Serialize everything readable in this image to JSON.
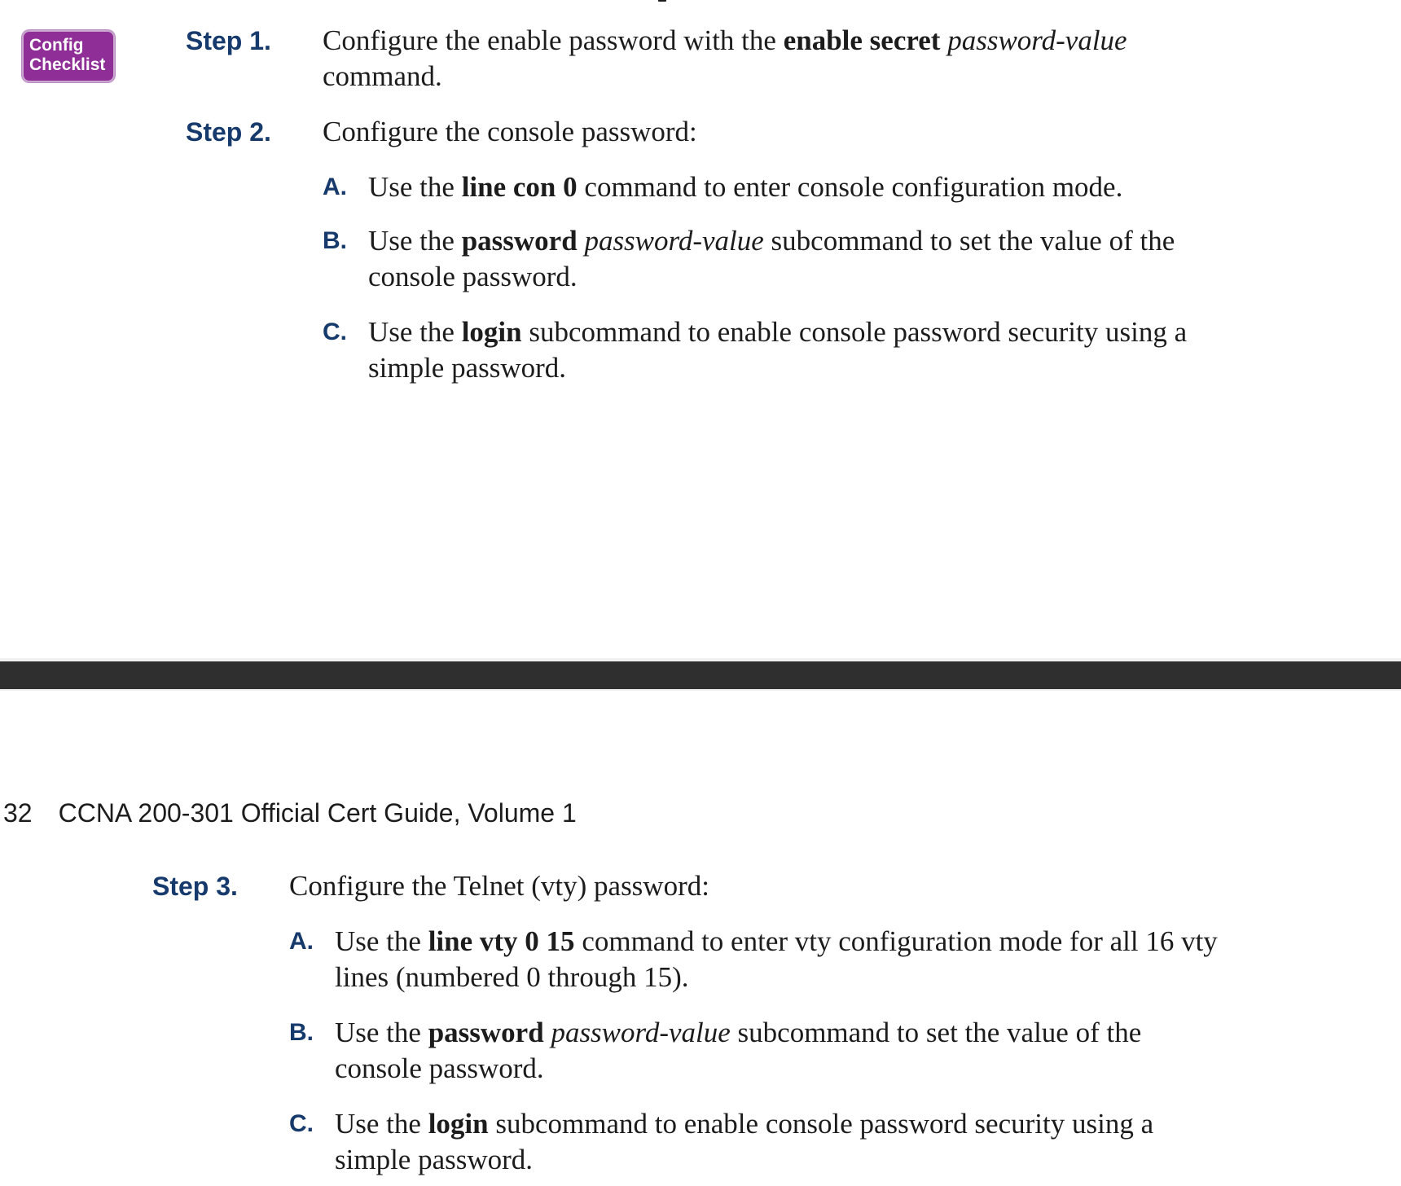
{
  "badge": {
    "line1": "Config",
    "line2": "Checklist"
  },
  "page_top": {
    "step1": {
      "label": "Step 1.",
      "text_pre": "Configure the enable password with the ",
      "text_bold": "enable secret",
      "text_space": " ",
      "text_italic": "password-value",
      "text_post": "command."
    },
    "step2": {
      "label": "Step 2.",
      "text": "Configure the console password:",
      "items": [
        {
          "label": "A.",
          "pre": "Use the ",
          "bold": "line con 0",
          "post": " command to enter console configuration mode."
        },
        {
          "label": "B.",
          "pre": "Use the ",
          "bold": "password",
          "space": " ",
          "italic": "password-value",
          "post": " subcommand to set the value of the console password."
        },
        {
          "label": "C.",
          "pre": "Use the ",
          "bold": "login",
          "post": " subcommand to enable console password security using a simple password."
        }
      ]
    }
  },
  "running_header": {
    "page_number": "32",
    "book_title": "CCNA 200-301 Official Cert Guide, Volume 1"
  },
  "page_bottom": {
    "step3": {
      "label": "Step 3.",
      "text": "Configure the Telnet (vty) password:",
      "items": [
        {
          "label": "A.",
          "pre": "Use the ",
          "bold": "line vty 0 15",
          "post": " command to enter vty configuration mode for all 16 vty lines (numbered 0 through 15)."
        },
        {
          "label": "B.",
          "pre": "Use the ",
          "bold": "password",
          "space": " ",
          "italic": "password-value",
          "post": " subcommand to set the value of the console password."
        },
        {
          "label": "C.",
          "pre": "Use the ",
          "bold": "login",
          "post": " subcommand to enable console password security using a simple password."
        }
      ]
    }
  },
  "colors": {
    "badge_bg": "#8e2e96",
    "step_label": "#163a6b",
    "divider": "#2f2f2f"
  }
}
